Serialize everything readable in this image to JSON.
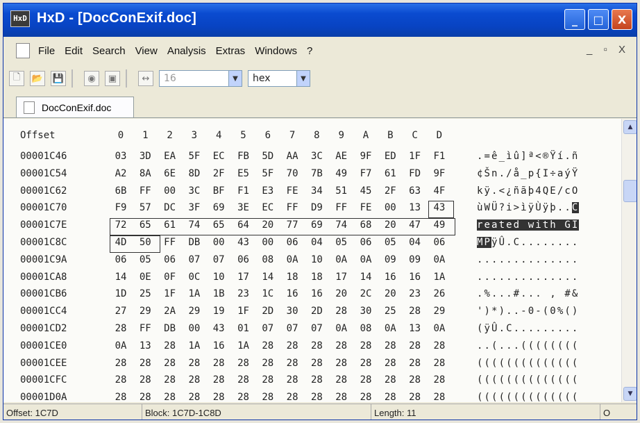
{
  "window": {
    "title": "HxD - [DocConExif.doc]",
    "app_icon_label": "HxD",
    "buttons": {
      "minimize": "_",
      "maximize": "□",
      "close": "X"
    }
  },
  "menu": {
    "items": [
      "File",
      "Edit",
      "Search",
      "View",
      "Analysis",
      "Extras",
      "Windows",
      "?"
    ],
    "mdi_controls": "_ ▫ X"
  },
  "toolbar": {
    "bytes_per_row": "16",
    "display_mode": "hex"
  },
  "tab": {
    "label": "DocConExif.doc"
  },
  "hex_header": {
    "offset_label": "Offset",
    "columns": [
      "0",
      "1",
      "2",
      "3",
      "4",
      "5",
      "6",
      "7",
      "8",
      "9",
      "A",
      "B",
      "C",
      "D"
    ]
  },
  "rows": [
    {
      "offset": "00001C46",
      "bytes": [
        "03",
        "3D",
        "EA",
        "5F",
        "EC",
        "FB",
        "5D",
        "AA",
        "3C",
        "AE",
        "9F",
        "ED",
        "1F",
        "F1"
      ],
      "ascii": ".=ê_ìû]ª<®Ÿí.ñ"
    },
    {
      "offset": "00001C54",
      "bytes": [
        "A2",
        "8A",
        "6E",
        "8D",
        "2F",
        "E5",
        "5F",
        "70",
        "7B",
        "49",
        "F7",
        "61",
        "FD",
        "9F"
      ],
      "ascii": "¢Šn./å_p{I÷aýŸ"
    },
    {
      "offset": "00001C62",
      "bytes": [
        "6B",
        "FF",
        "00",
        "3C",
        "BF",
        "F1",
        "E3",
        "FE",
        "34",
        "51",
        "45",
        "2F",
        "63",
        "4F"
      ],
      "ascii": "kÿ.<¿ñãþ4QE/cO"
    },
    {
      "offset": "00001C70",
      "bytes": [
        "F9",
        "57",
        "DC",
        "3F",
        "69",
        "3E",
        "EC",
        "FF",
        "D9",
        "FF",
        "FE",
        "00",
        "13",
        "43"
      ],
      "ascii": "ùWÜ?i>ìÿÙÿþ..C"
    },
    {
      "offset": "00001C7E",
      "bytes": [
        "72",
        "65",
        "61",
        "74",
        "65",
        "64",
        "20",
        "77",
        "69",
        "74",
        "68",
        "20",
        "47",
        "49"
      ],
      "ascii": "reated with GI"
    },
    {
      "offset": "00001C8C",
      "bytes": [
        "4D",
        "50",
        "FF",
        "DB",
        "00",
        "43",
        "00",
        "06",
        "04",
        "05",
        "06",
        "05",
        "04",
        "06"
      ],
      "ascii": "MPÿÛ.C........"
    },
    {
      "offset": "00001C9A",
      "bytes": [
        "06",
        "05",
        "06",
        "07",
        "07",
        "06",
        "08",
        "0A",
        "10",
        "0A",
        "0A",
        "09",
        "09",
        "0A"
      ],
      "ascii": ".............."
    },
    {
      "offset": "00001CA8",
      "bytes": [
        "14",
        "0E",
        "0F",
        "0C",
        "10",
        "17",
        "14",
        "18",
        "18",
        "17",
        "14",
        "16",
        "16",
        "1A"
      ],
      "ascii": ".............."
    },
    {
      "offset": "00001CB6",
      "bytes": [
        "1D",
        "25",
        "1F",
        "1A",
        "1B",
        "23",
        "1C",
        "16",
        "16",
        "20",
        "2C",
        "20",
        "23",
        "26"
      ],
      "ascii": ".%...#... , #&"
    },
    {
      "offset": "00001CC4",
      "bytes": [
        "27",
        "29",
        "2A",
        "29",
        "19",
        "1F",
        "2D",
        "30",
        "2D",
        "28",
        "30",
        "25",
        "28",
        "29"
      ],
      "ascii": "')*)..-0-(0%()"
    },
    {
      "offset": "00001CD2",
      "bytes": [
        "28",
        "FF",
        "DB",
        "00",
        "43",
        "01",
        "07",
        "07",
        "07",
        "0A",
        "08",
        "0A",
        "13",
        "0A"
      ],
      "ascii": "(ÿÛ.C........."
    },
    {
      "offset": "00001CE0",
      "bytes": [
        "0A",
        "13",
        "28",
        "1A",
        "16",
        "1A",
        "28",
        "28",
        "28",
        "28",
        "28",
        "28",
        "28",
        "28"
      ],
      "ascii": "..(...(((((((("
    },
    {
      "offset": "00001CEE",
      "bytes": [
        "28",
        "28",
        "28",
        "28",
        "28",
        "28",
        "28",
        "28",
        "28",
        "28",
        "28",
        "28",
        "28",
        "28"
      ],
      "ascii": "(((((((((((((("
    },
    {
      "offset": "00001CFC",
      "bytes": [
        "28",
        "28",
        "28",
        "28",
        "28",
        "28",
        "28",
        "28",
        "28",
        "28",
        "28",
        "28",
        "28",
        "28"
      ],
      "ascii": "(((((((((((((("
    },
    {
      "offset": "00001D0A",
      "bytes": [
        "28",
        "28",
        "28",
        "28",
        "28",
        "28",
        "28",
        "28",
        "28",
        "28",
        "28",
        "28",
        "28",
        "28"
      ],
      "ascii": "(((((((((((((("
    }
  ],
  "status": {
    "offset": "Offset: 1C7D",
    "block": "Block: 1C7D-1C8D",
    "length": "Length: 11",
    "mode": "O"
  }
}
